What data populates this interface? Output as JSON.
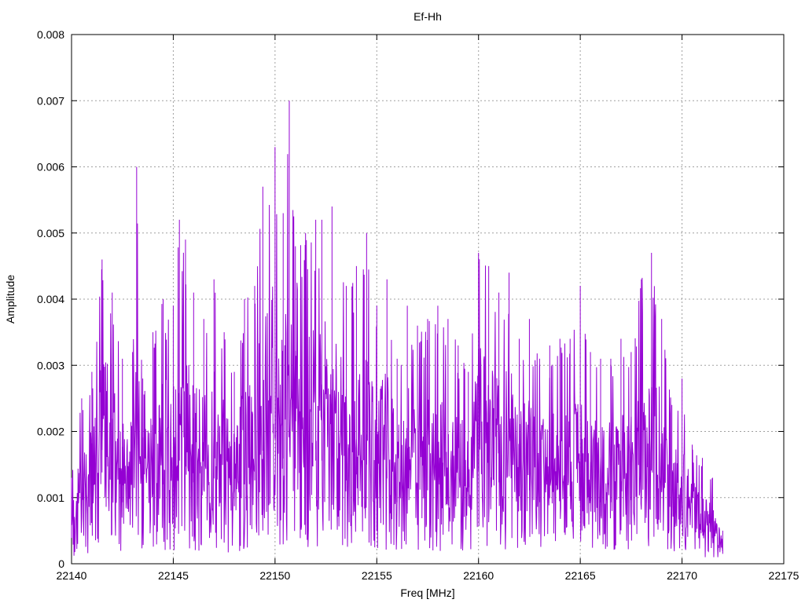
{
  "chart_data": {
    "type": "line",
    "title": "Ef-Hh",
    "xlabel": "Freq [MHz]",
    "ylabel": "Amplitude",
    "xlim": [
      22140,
      22175
    ],
    "ylim": [
      0,
      0.008
    ],
    "x_ticks": [
      22140,
      22145,
      22150,
      22155,
      22160,
      22165,
      22170,
      22175
    ],
    "y_ticks": [
      0,
      0.001,
      0.002,
      0.003,
      0.004,
      0.005,
      0.006,
      0.007,
      0.008
    ],
    "x_tick_labels": [
      "22140",
      "22145",
      "22150",
      "22155",
      "22160",
      "22165",
      "22170",
      "22175"
    ],
    "y_tick_labels": [
      "0",
      "0.001",
      "0.002",
      "0.003",
      "0.004",
      "0.005",
      "0.006",
      "0.007",
      "0.008"
    ],
    "grid": true,
    "legend": "none",
    "series_color": "#9400d3",
    "series": [
      {
        "x": [
          22140.0,
          22140.5,
          22141.0,
          22141.5,
          22142.0,
          22142.5,
          22143.0,
          22143.2,
          22143.5,
          22144.0,
          22144.5,
          22145.0,
          22145.3,
          22145.6,
          22146.0,
          22146.5,
          22147.0,
          22147.5,
          22148.0,
          22148.5,
          22149.0,
          22149.4,
          22150.0,
          22150.4,
          22150.7,
          22151.0,
          22151.5,
          22152.0,
          22152.3,
          22152.8,
          22153.5,
          22154.0,
          22154.5,
          22155.0,
          22155.5,
          22156.0,
          22156.5,
          22157.0,
          22157.5,
          22158.0,
          22158.5,
          22159.0,
          22159.5,
          22160.0,
          22160.5,
          22161.0,
          22161.5,
          22162.0,
          22162.5,
          22163.0,
          22163.5,
          22164.0,
          22164.5,
          22165.0,
          22165.5,
          22166.0,
          22166.5,
          22167.0,
          22167.5,
          22168.0,
          22168.5,
          22169.0,
          22169.5,
          22170.0,
          22170.5,
          22171.0,
          22171.5,
          22172.0
        ],
        "y": [
          0.0013,
          0.0025,
          0.0029,
          0.0046,
          0.0041,
          0.0031,
          0.0032,
          0.006,
          0.0028,
          0.0035,
          0.004,
          0.0039,
          0.0052,
          0.0049,
          0.0041,
          0.0037,
          0.0043,
          0.0035,
          0.0029,
          0.004,
          0.0042,
          0.0057,
          0.0063,
          0.0053,
          0.007,
          0.0048,
          0.005,
          0.0052,
          0.0052,
          0.0054,
          0.0042,
          0.0045,
          0.005,
          0.0039,
          0.0043,
          0.0031,
          0.0039,
          0.0036,
          0.0037,
          0.0039,
          0.0037,
          0.0033,
          0.0029,
          0.0047,
          0.0045,
          0.0041,
          0.0044,
          0.0034,
          0.0037,
          0.0031,
          0.0033,
          0.0034,
          0.0034,
          0.0042,
          0.0032,
          0.0031,
          0.0031,
          0.0034,
          0.0032,
          0.0043,
          0.0047,
          0.0037,
          0.0024,
          0.0028,
          0.0018,
          0.0016,
          0.0013,
          0.0005
        ]
      }
    ]
  }
}
